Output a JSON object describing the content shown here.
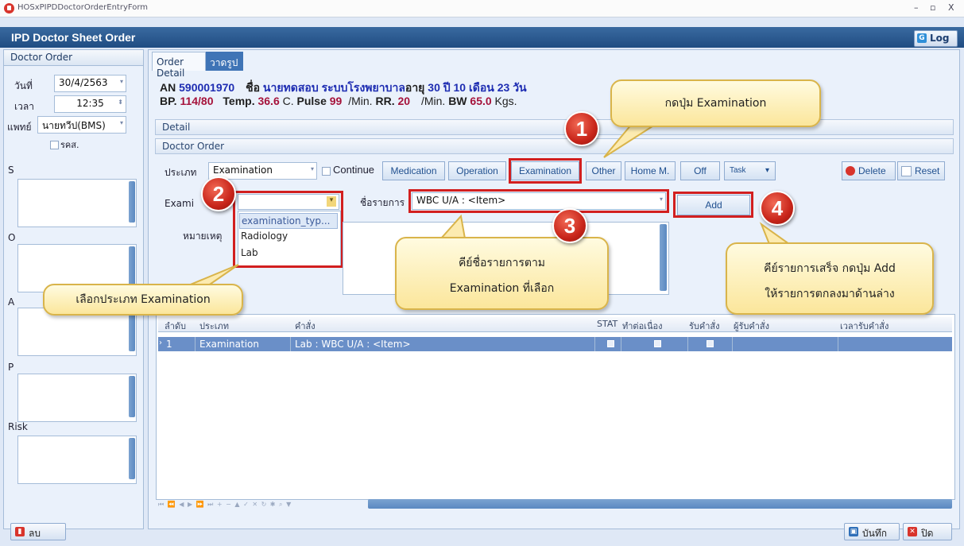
{
  "window": {
    "title": "HOSxPIPDDoctorOrderEntryForm",
    "controls": [
      "–",
      "▫",
      "X"
    ]
  },
  "header": {
    "title": "IPD Doctor Sheet Order",
    "log_label": "Log"
  },
  "left": {
    "title": "Doctor Order",
    "date_label": "วันที่",
    "date_value": "30/4/2563",
    "time_label": "เวลา",
    "time_value": "12:35",
    "doctor_label": "แพทย์",
    "doctor_value": "นายทวีป(BMS)",
    "rod_label": "รคส.",
    "memos": [
      "S",
      "O",
      "A",
      "P",
      "Risk"
    ]
  },
  "tabs": [
    {
      "label": "Order Detail"
    },
    {
      "label": "วาดรูป"
    }
  ],
  "patient": {
    "an_label": "AN",
    "an_value": "590001970",
    "name_label": "ชื่อ",
    "name_value": "นายทดสอบ ระบบโรงพยาบาล",
    "age_label": "อายุ",
    "age_value": "30 ปี 10 เดือน 23 วัน",
    "bp_label": "BP.",
    "bp_sys": "114",
    "bp_dia": "/80",
    "temp_label": "Temp.",
    "temp_value": "36.6",
    "temp_unit": "C.",
    "pulse_label": "Pulse",
    "pulse_value": "99",
    "pulse_unit": "/Min.",
    "rr_label": "RR.",
    "rr_value": "20",
    "rr_unit": "/Min.",
    "bw_label": "BW",
    "bw_value": "65.0",
    "bw_unit": "Kgs."
  },
  "sections": {
    "detail": "Detail",
    "doctor_order": "Doctor Order"
  },
  "order_type": {
    "label": "ประเภท",
    "value": "Examination",
    "continue_label": "Continue"
  },
  "type_buttons": [
    "Medication",
    "Operation",
    "Examination",
    "Other",
    "Home M.",
    "Off",
    "Task"
  ],
  "actions": {
    "delete": "Delete",
    "reset": "Reset"
  },
  "exam": {
    "label": "Exami",
    "dropdown_items": [
      "examination_typ...",
      "Radiology",
      "Lab"
    ],
    "item_label": "ชื่อรายการ",
    "item_value": "WBC U/A : <Item>",
    "add": "Add",
    "note_label": "หมายเหตุ"
  },
  "grid": {
    "headers": [
      "ลำดับ",
      "ประเภท",
      "คำสั่ง",
      "STAT",
      "ทำต่อเนื่อง",
      "รับคำสั่ง",
      "ผู้รับคำสั่ง",
      "เวลารับคำสั่ง"
    ],
    "row": {
      "no": "1",
      "type": "Examination",
      "order": "Lab : WBC U/A : <Item>"
    }
  },
  "callouts": {
    "c1": "กดปุ่ม Examination",
    "c2": "เลือกประเภท Examination",
    "c3_line1": "คีย์ชื่อรายการตาม",
    "c3_line2": "Examination ที่เลือก",
    "c4_line1": "คีย์รายการเสร็จ กดปุ่ม Add",
    "c4_line2": "ให้รายการตกลงมาด้านล่าง"
  },
  "markers": [
    "1",
    "2",
    "3",
    "4"
  ],
  "footer": {
    "delete": "ลบ",
    "save": "บันทึก",
    "close": "ปิด"
  },
  "colors": {
    "header": "#1f4c82",
    "selected_row": "#6a8fc8",
    "highlight": "#d21f1f",
    "callout": "#fbe69b"
  }
}
